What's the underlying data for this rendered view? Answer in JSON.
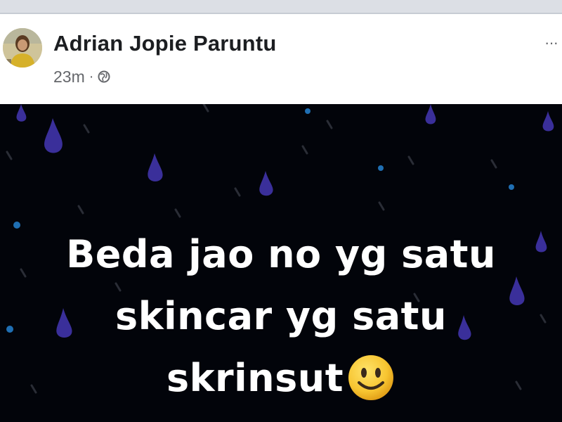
{
  "post": {
    "author": "Adrian Jopie Paruntu",
    "time": "23m",
    "separator": "·",
    "privacy_icon": "globe-icon",
    "more_icon": "more-options-icon",
    "more_label": "···"
  },
  "image": {
    "background": "#02040a",
    "drop_color": "#3a2f9a",
    "text_lines": [
      "Beda jao no yg satu",
      "skincar yg satu",
      "skrinsut"
    ],
    "emoji": "smiling-face-emoji"
  }
}
